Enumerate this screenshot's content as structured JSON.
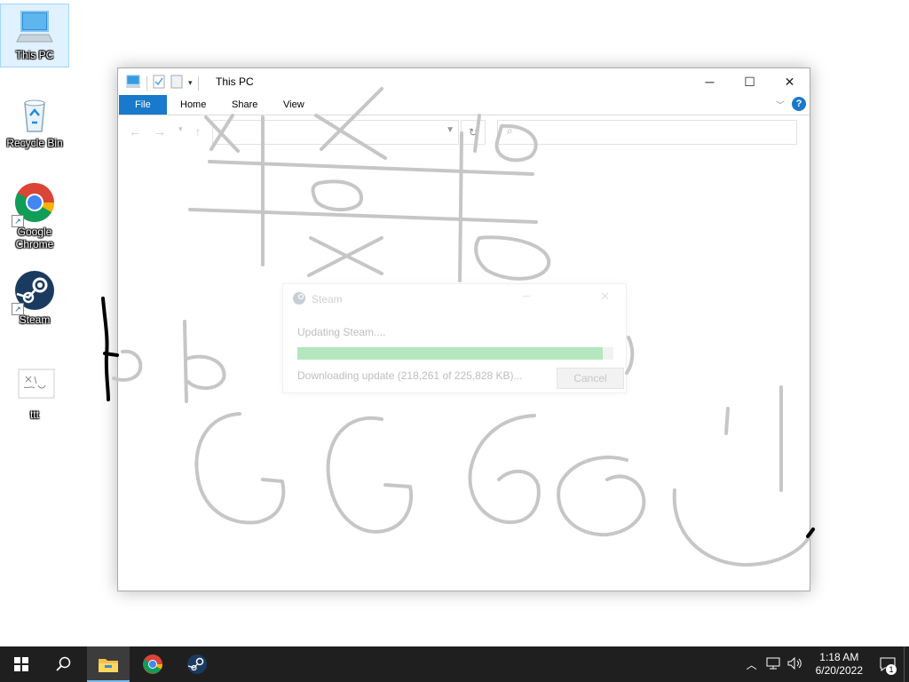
{
  "desktop": {
    "icons": [
      {
        "label": "This PC",
        "icon": "computer-icon"
      },
      {
        "label": "Recycle Bin",
        "icon": "recycle-bin-icon"
      },
      {
        "label": "Google Chrome",
        "icon": "chrome-icon"
      },
      {
        "label": "Steam",
        "icon": "steam-icon"
      },
      {
        "label": "ttt",
        "icon": "image-file-icon"
      }
    ]
  },
  "explorer": {
    "title": "This PC",
    "tabs": [
      "File",
      "Home",
      "Share",
      "View"
    ],
    "help": "?"
  },
  "steam_dialog": {
    "title": "Steam",
    "status": "Updating Steam....",
    "progress_fraction": 0.966,
    "download_text": "Downloading update (218,261 of 225,828 KB)...",
    "cancel_label": "Cancel"
  },
  "taskbar": {
    "apps": [
      "start-icon",
      "search-icon",
      "file-explorer-icon",
      "chrome-icon",
      "steam-icon"
    ],
    "time": "1:18 AM",
    "date": "6/20/2022",
    "notification_count": "1"
  },
  "colors": {
    "accent": "#1979ca",
    "progress": "#79d48a",
    "taskbar": "#1f1f1f"
  }
}
